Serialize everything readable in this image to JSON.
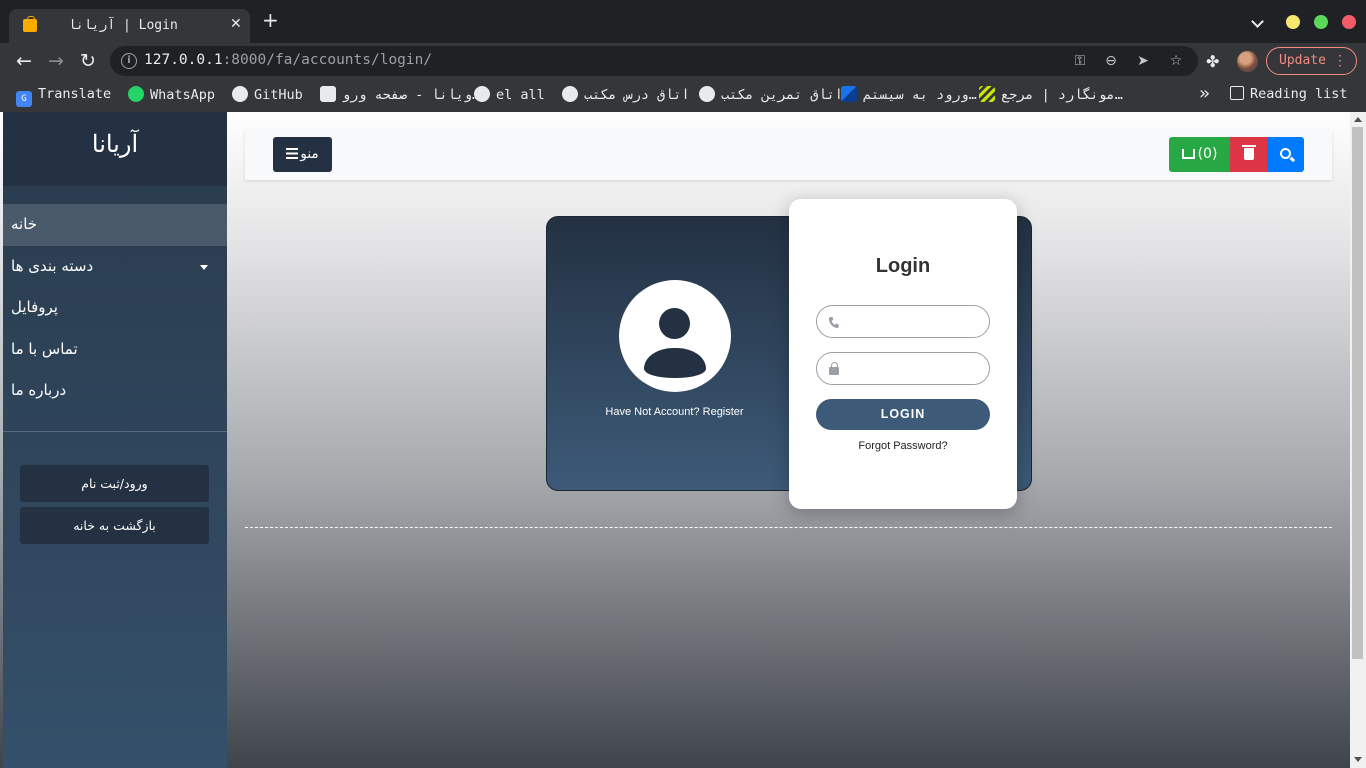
{
  "browser": {
    "tab_title": "آریانا | Login",
    "url_host": "127.0.0.1",
    "url_rest": ":8000/fa/accounts/login/",
    "update_label": "Update",
    "bookmarks": [
      {
        "label": "Translate",
        "icon": "google-translate-icon"
      },
      {
        "label": "WhatsApp",
        "icon": "whatsapp-icon"
      },
      {
        "label": "GitHub",
        "icon": "github-icon"
      },
      {
        "label": "ویانا - صفحه ورو…",
        "icon": "document-icon"
      },
      {
        "label": "el all",
        "icon": "person-icon"
      },
      {
        "label": "اتاق درس مکتب",
        "icon": "person-icon"
      },
      {
        "label": "اتاق تمرین مکتب",
        "icon": "person-icon"
      },
      {
        "label": "ورود به سیستم…",
        "icon": "moodle-icon"
      },
      {
        "label": "مونگارد | مرجع…",
        "icon": "mongard-icon"
      }
    ],
    "reading_list": "Reading list"
  },
  "sidebar": {
    "brand": "آریانا",
    "items": [
      {
        "label": "خانه",
        "active": true
      },
      {
        "label": "دسته بندی ها",
        "has_dropdown": true
      },
      {
        "label": "پروفایل"
      },
      {
        "label": "تماس با ما"
      },
      {
        "label": "درباره ما"
      }
    ],
    "login_button": "ورود/ثبت نام",
    "home_button": "بازگشت به خانه"
  },
  "topnav": {
    "menu_label": "منو",
    "cart_count": "(0)"
  },
  "login": {
    "title": "Login",
    "register_text": "Have Not Account? Register",
    "phone_placeholder": "",
    "password_placeholder": "",
    "button_label": "LOGIN",
    "forgot_text": "Forgot Password?"
  },
  "colors": {
    "primary_dark": "#233142",
    "primary": "#3d5a78",
    "cart_green": "#28a745",
    "trash_red": "#dc3545",
    "search_blue": "#007bff"
  }
}
